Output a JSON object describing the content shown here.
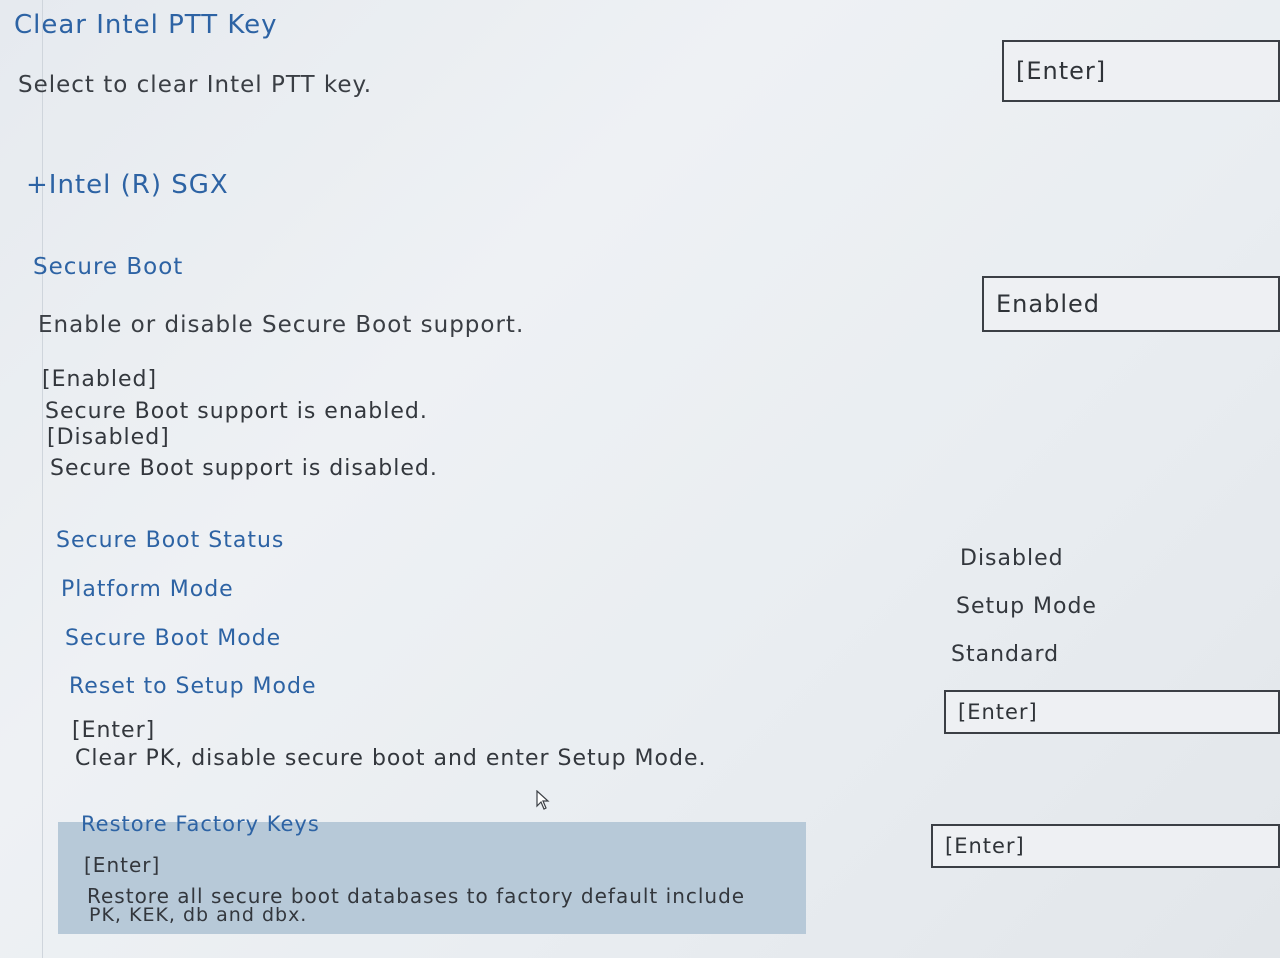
{
  "ptt": {
    "title": "Clear Intel PTT Key",
    "description": "Select to clear Intel PTT key.",
    "value": "[Enter]"
  },
  "sgx": {
    "label": "+Intel (R) SGX"
  },
  "secure_boot": {
    "title": "Secure Boot",
    "description": "Enable or disable Secure Boot support.",
    "value": "Enabled",
    "help": {
      "enabled_label": "[Enabled]",
      "enabled_desc": "Secure Boot support is enabled.",
      "disabled_label": "[Disabled]",
      "disabled_desc": "Secure Boot support is disabled."
    }
  },
  "status": {
    "secure_boot_status_label": "Secure Boot Status",
    "secure_boot_status_value": "Disabled",
    "platform_mode_label": "Platform Mode",
    "platform_mode_value": "Setup Mode",
    "secure_boot_mode_label": "Secure Boot Mode",
    "secure_boot_mode_value": "Standard"
  },
  "reset_setup": {
    "label": "Reset to Setup Mode",
    "help_key": "[Enter]",
    "help_desc": "Clear PK, disable secure boot and enter Setup Mode.",
    "value": "[Enter]"
  },
  "restore_keys": {
    "label": "Restore Factory Keys",
    "help_key": "[Enter]",
    "help_desc_line1": "Restore all secure boot databases to factory default include",
    "help_desc_line2": "PK, KEK, db and dbx.",
    "value": "[Enter]"
  },
  "colors": {
    "accent": "#2d63a4",
    "highlight": "#b7c9d8",
    "background": "#e9edf1"
  },
  "icons": {
    "cursor": "mouse-pointer-icon"
  }
}
